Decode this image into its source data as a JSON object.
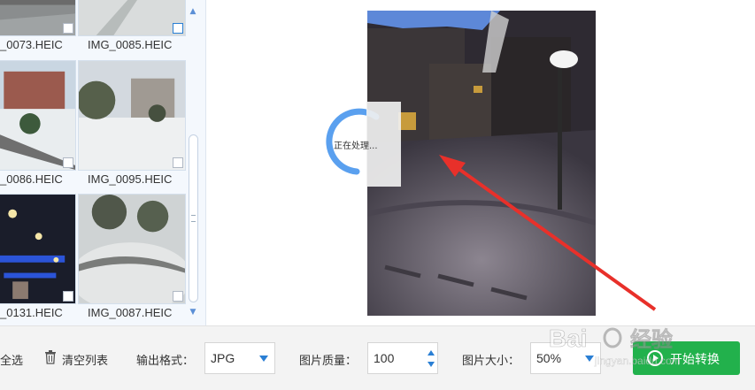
{
  "thumbnails": [
    {
      "label": "_0073.HEIC"
    },
    {
      "label": "IMG_0085.HEIC"
    },
    {
      "label": "_0086.HEIC"
    },
    {
      "label": "IMG_0095.HEIC"
    },
    {
      "label": "_0131.HEIC"
    },
    {
      "label": "IMG_0087.HEIC"
    }
  ],
  "preview": {
    "processing_text": "正在处理..."
  },
  "toolbar": {
    "select_all_label": "全选",
    "clear_list_label": "清空列表",
    "output_format_label": "输出格式：",
    "output_format_value": "JPG",
    "quality_label": "图片质量：",
    "quality_value": "100",
    "size_label": "图片大小：",
    "size_value": "50%",
    "start_label": "开始转换"
  },
  "colors": {
    "accent": "#2a7fd4",
    "start_button": "#22b14c",
    "arrow": "#e8302a"
  }
}
